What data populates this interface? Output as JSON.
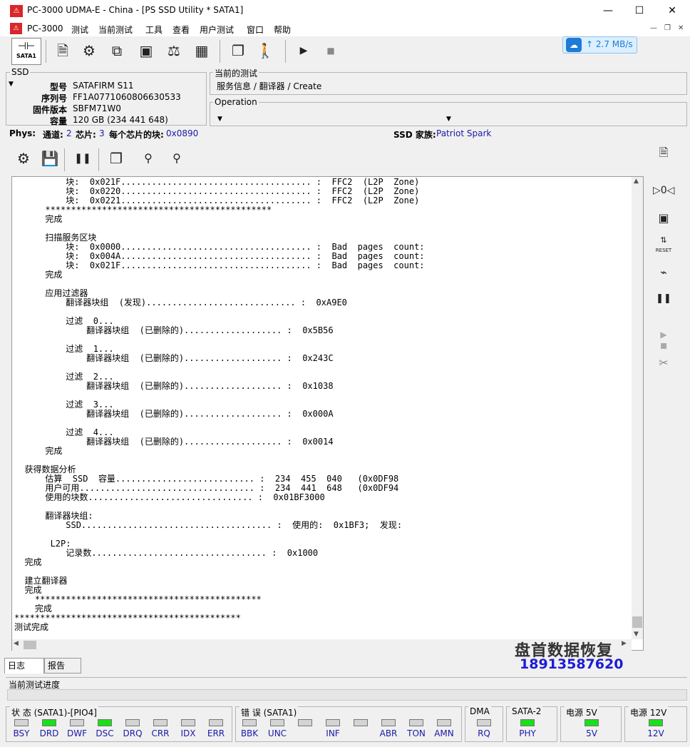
{
  "window": {
    "app_icon": "pc3000-icon",
    "title": "PC-3000 UDMA-E - China - [PS SSD Utility * SATA1]",
    "minimize": "—",
    "maximize": "☐",
    "close": "✕"
  },
  "menu": {
    "items": [
      "PC-3000",
      "测试",
      "当前测试",
      "工具",
      "查看",
      "用户测试",
      "窗口",
      "帮助"
    ],
    "mdi_minimize": "—",
    "mdi_restore": "❐",
    "mdi_close": "✕"
  },
  "toolbar": {
    "sata_label": "SATA1",
    "speed": "2.7 MB/s"
  },
  "ssd": {
    "group_title": "SSD",
    "model_label": "型号",
    "model_value": "SATAFIRM   S11",
    "serial_label": "序列号",
    "serial_value": "FF1A0771060806630533",
    "firmware_label": "固件版本",
    "firmware_value": "SBFM71W0",
    "capacity_label": "容量",
    "capacity_value": "120 GB (234 441 648)"
  },
  "current_test": {
    "group_title": "当前的测试",
    "value": "服务信息 / 翻译器 / Create"
  },
  "operation": {
    "group_title": "Operation"
  },
  "phys": {
    "label": "Phys:",
    "channels_label": "通道:",
    "channels_value": "2",
    "chips_label": "芯片:",
    "chips_value": "3",
    "blocks_label": "每个芯片的块:",
    "blocks_value": "0x0890",
    "family_label": "SSD 家族:",
    "family_value": "Patriot Spark"
  },
  "log": {
    "lines": [
      {
        "text": "          块:  0x021F..................................... :  FFC2  (L2P  Zone)",
        "red": false
      },
      {
        "text": "          块:  0x0220..................................... :  FFC2  (L2P  Zone)",
        "red": false
      },
      {
        "text": "          块:  0x0221..................................... :  FFC2  (L2P  Zone)",
        "red": false
      },
      {
        "text": "      ********************************************",
        "red": false
      },
      {
        "text": "      完成",
        "red": false
      },
      {
        "text": "",
        "red": false
      },
      {
        "text": "      扫描服务区块",
        "red": false
      },
      {
        "text": "          块:  0x0000..................................... :  Bad  pages  count:",
        "red": true
      },
      {
        "text": "          块:  0x004A..................................... :  Bad  pages  count:",
        "red": true
      },
      {
        "text": "          块:  0x021F..................................... :  Bad  pages  count:",
        "red": true
      },
      {
        "text": "      完成",
        "red": false
      },
      {
        "text": "",
        "red": false
      },
      {
        "text": "      应用过滤器",
        "red": false
      },
      {
        "text": "          翻译器块组  (发现)............................. :  0xA9E0",
        "red": false
      },
      {
        "text": "",
        "red": false
      },
      {
        "text": "          过滤  0...",
        "red": false
      },
      {
        "text": "              翻译器块组  (已删除的)................... :  0x5B56",
        "red": false
      },
      {
        "text": "",
        "red": false
      },
      {
        "text": "          过滤  1...",
        "red": false
      },
      {
        "text": "              翻译器块组  (已删除的)................... :  0x243C",
        "red": false
      },
      {
        "text": "",
        "red": false
      },
      {
        "text": "          过滤  2...",
        "red": false
      },
      {
        "text": "              翻译器块组  (已删除的)................... :  0x1038",
        "red": false
      },
      {
        "text": "",
        "red": false
      },
      {
        "text": "          过滤  3...",
        "red": false
      },
      {
        "text": "              翻译器块组  (已删除的)................... :  0x000A",
        "red": false
      },
      {
        "text": "",
        "red": false
      },
      {
        "text": "          过滤  4...",
        "red": false
      },
      {
        "text": "              翻译器块组  (已删除的)................... :  0x0014",
        "red": true
      },
      {
        "text": "      完成",
        "red": false
      },
      {
        "text": "",
        "red": false
      },
      {
        "text": "  获得数据分析",
        "red": false
      },
      {
        "text": "      估算  SSD  容量........................... :  234  455  040   (0x0DF98",
        "red": false
      },
      {
        "text": "      用户可用.................................. :  234  441  648   (0x0DF94",
        "red": false
      },
      {
        "text": "      使用的块数................................ :  0x01BF3000",
        "red": false
      },
      {
        "text": "",
        "red": false
      },
      {
        "text": "      翻译器块组:",
        "red": false
      },
      {
        "text": "          SSD..................................... :  使用的:  0x1BF3;  发现:",
        "red": false
      },
      {
        "text": "",
        "red": false
      },
      {
        "text": "       L2P:",
        "red": false
      },
      {
        "text": "          记录数.................................. :  0x1000",
        "red": false
      },
      {
        "text": "  完成",
        "red": false
      },
      {
        "text": "",
        "red": false
      },
      {
        "text": "  建立翻译器",
        "red": false
      },
      {
        "text": "  完成",
        "red": false
      },
      {
        "text": "    ********************************************",
        "red": false
      },
      {
        "text": "    完成",
        "red": false
      },
      {
        "text": "********************************************",
        "red": false
      },
      {
        "text": "测试完成",
        "red": false
      }
    ]
  },
  "watermark": {
    "line1": "盘首数据恢复",
    "line2": "18913587620"
  },
  "tabs": {
    "log": "日志",
    "report": "报告"
  },
  "progress": {
    "label": "当前测试进度"
  },
  "status": {
    "group1_title": "状 态 (SATA1)-[PIO4]",
    "group1_leds": [
      {
        "label": "BSY",
        "on": false
      },
      {
        "label": "DRD",
        "on": true
      },
      {
        "label": "DWF",
        "on": false
      },
      {
        "label": "DSC",
        "on": true
      },
      {
        "label": "DRQ",
        "on": false
      },
      {
        "label": "CRR",
        "on": false
      },
      {
        "label": "IDX",
        "on": false
      },
      {
        "label": "ERR",
        "on": false
      }
    ],
    "group2_title": "错 误 (SATA1)",
    "group2_leds": [
      {
        "label": "BBK",
        "on": false
      },
      {
        "label": "UNC",
        "on": false
      },
      {
        "label": "",
        "on": false
      },
      {
        "label": "INF",
        "on": false
      },
      {
        "label": "",
        "on": false
      },
      {
        "label": "ABR",
        "on": false
      },
      {
        "label": "TON",
        "on": false
      },
      {
        "label": "AMN",
        "on": false
      }
    ],
    "dma_title": "DMA",
    "dma_led": {
      "label": "RQ",
      "on": false
    },
    "sata2_title": "SATA-2",
    "sata2_led": {
      "label": "PHY",
      "on": true
    },
    "p5_title": "电源 5V",
    "p5_led": {
      "label": "5V",
      "on": true
    },
    "p12_title": "电源 12V",
    "p12_led": {
      "label": "12V",
      "on": true
    }
  }
}
